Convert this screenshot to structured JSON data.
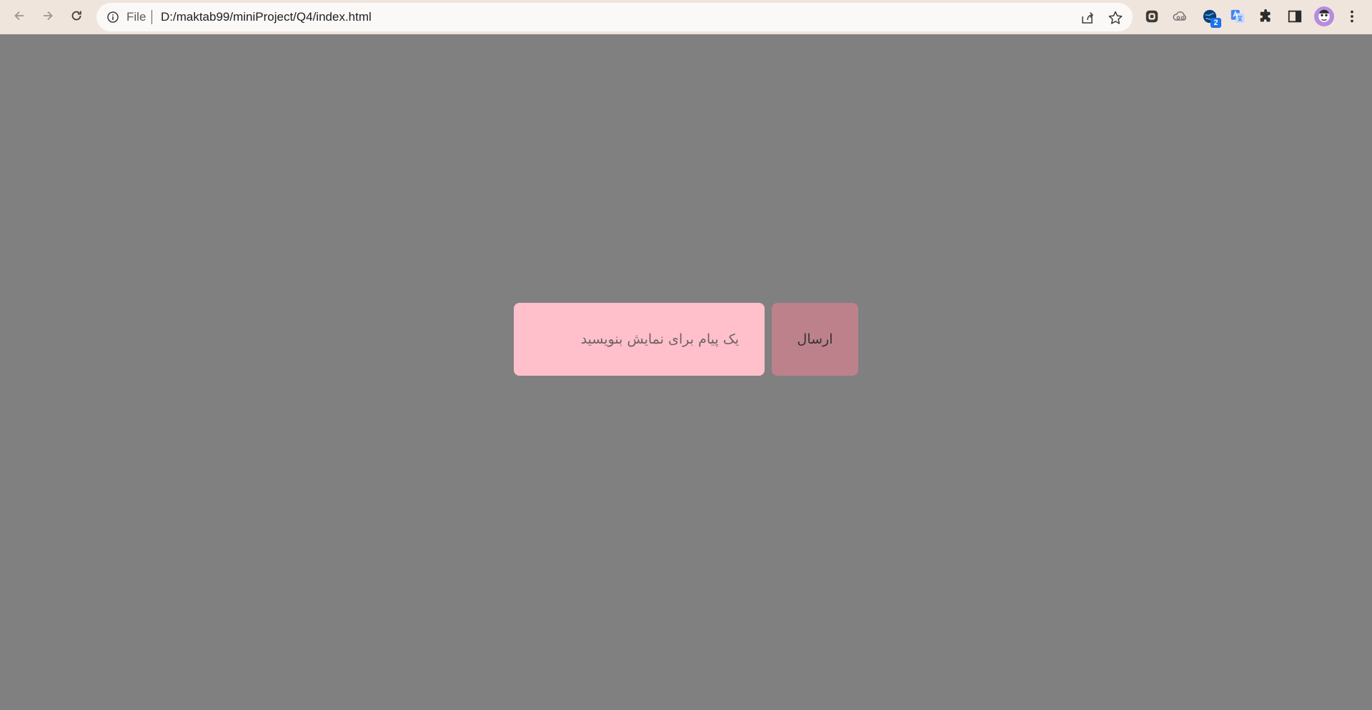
{
  "browser": {
    "scheme_label": "File",
    "url": "D:/maktab99/miniProject/Q4/index.html",
    "extension_badge": "2",
    "icons": {
      "back": "arrow-left-icon",
      "forward": "arrow-right-icon",
      "reload": "reload-icon",
      "site_info": "info-icon",
      "share": "share-icon",
      "bookmark": "star-icon",
      "extensions": [
        "extension-square-icon",
        "extension-cloud-icon",
        "extension-globe-icon",
        "google-translate-icon",
        "puzzle-icon",
        "side-panel-icon"
      ],
      "profile": "avatar",
      "menu": "kebab-menu-icon"
    }
  },
  "page": {
    "background_color": "#808080",
    "message_input": {
      "placeholder": "یک پیام برای نمایش بنویسید",
      "value": "",
      "color": "#ffc0cb"
    },
    "send_button": {
      "label": "ارسال",
      "color": "#bd818c"
    }
  }
}
